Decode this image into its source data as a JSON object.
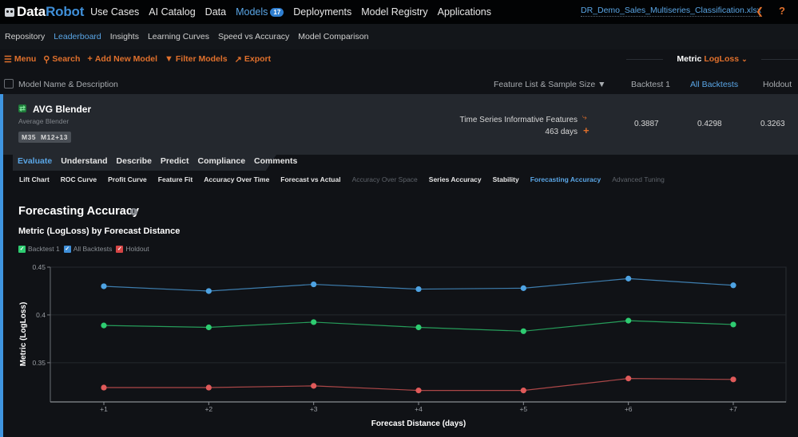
{
  "header": {
    "logo": {
      "part1": "Data",
      "part2": "Robot"
    },
    "nav": [
      {
        "label": "Use Cases",
        "active": false
      },
      {
        "label": "AI Catalog",
        "active": false
      },
      {
        "label": "Data",
        "active": false
      },
      {
        "label": "Models",
        "active": true,
        "badge": "17"
      },
      {
        "label": "Deployments",
        "active": false
      },
      {
        "label": "Model Registry",
        "active": false
      },
      {
        "label": "Applications",
        "active": false
      }
    ],
    "project_name": "DR_Demo_Sales_Multiseries_Classification.xlsx",
    "icons": {
      "share": "share-icon",
      "help": "help-icon"
    }
  },
  "subnav": [
    {
      "label": "Repository",
      "active": false
    },
    {
      "label": "Leaderboard",
      "active": true
    },
    {
      "label": "Insights",
      "active": false
    },
    {
      "label": "Learning Curves",
      "active": false
    },
    {
      "label": "Speed vs Accuracy",
      "active": false
    },
    {
      "label": "Model Comparison",
      "active": false
    }
  ],
  "toolbar": {
    "menu": "Menu",
    "search": "Search",
    "add_model": "Add New Model",
    "filter": "Filter Models",
    "export": "Export",
    "metric_label": "Metric",
    "metric_value": "LogLoss"
  },
  "columns": {
    "name": "Model Name & Description",
    "feature_list": "Feature List & Sample Size",
    "backtest1": "Backtest 1",
    "all_backtests": "All Backtests",
    "holdout": "Holdout"
  },
  "model": {
    "name": "AVG Blender",
    "description": "Average Blender",
    "tags": [
      "M35",
      "M12+13"
    ],
    "feature_list": "Time Series Informative Features",
    "sample_size": "463 days",
    "backtest1": "0.3887",
    "all_backtests": "0.4298",
    "holdout": "0.3263"
  },
  "tabs": [
    {
      "label": "Evaluate",
      "active": true
    },
    {
      "label": "Understand",
      "active": false
    },
    {
      "label": "Describe",
      "active": false
    },
    {
      "label": "Predict",
      "active": false
    },
    {
      "label": "Compliance",
      "active": false
    },
    {
      "label": "Comments",
      "active": false
    }
  ],
  "subtabs": [
    {
      "label": "Lift Chart",
      "state": "normal"
    },
    {
      "label": "ROC Curve",
      "state": "normal"
    },
    {
      "label": "Profit Curve",
      "state": "normal"
    },
    {
      "label": "Feature Fit",
      "state": "normal"
    },
    {
      "label": "Accuracy Over Time",
      "state": "normal"
    },
    {
      "label": "Forecast vs Actual",
      "state": "normal"
    },
    {
      "label": "Accuracy Over Space",
      "state": "dim"
    },
    {
      "label": "Series Accuracy",
      "state": "normal"
    },
    {
      "label": "Stability",
      "state": "normal"
    },
    {
      "label": "Forecasting Accuracy",
      "state": "active"
    },
    {
      "label": "Advanced Tuning",
      "state": "dim"
    }
  ],
  "page_title": "Forecasting Accuracy",
  "chart_title": "Metric (LogLoss) by Forecast Distance",
  "chart_data": {
    "type": "line",
    "title": "Metric (LogLoss) by Forecast Distance",
    "xlabel": "Forecast Distance (days)",
    "ylabel": "Metric (LogLoss)",
    "x": [
      "+1",
      "+2",
      "+3",
      "+4",
      "+5",
      "+6",
      "+7"
    ],
    "ylim": [
      0.309,
      0.45
    ],
    "yticks": [
      0.35,
      0.4,
      0.45
    ],
    "ytick_labels": [
      "0.35",
      "0.4",
      "0.45"
    ],
    "grid": true,
    "legend_position": "top-left",
    "series": [
      {
        "name": "Backtest 1",
        "color": "#2ecc71",
        "values": [
          0.389,
          0.387,
          0.3925,
          0.387,
          0.383,
          0.394,
          0.39
        ]
      },
      {
        "name": "All Backtests",
        "color": "#4ea3e3",
        "values": [
          0.43,
          0.425,
          0.432,
          0.427,
          0.428,
          0.438,
          0.431
        ]
      },
      {
        "name": "Holdout",
        "color": "#e05a5a",
        "values": [
          0.324,
          0.324,
          0.3258,
          0.321,
          0.321,
          0.3335,
          0.3325
        ]
      }
    ]
  }
}
